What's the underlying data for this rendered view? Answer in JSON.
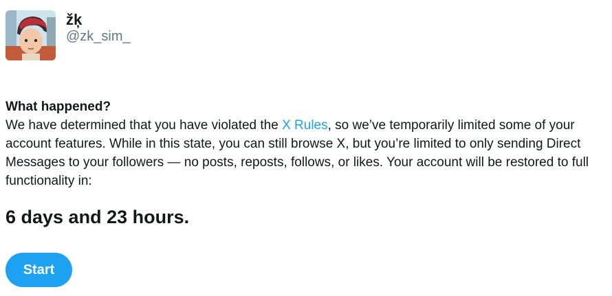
{
  "profile": {
    "display_name": "žķ",
    "handle": "@zk_sim_"
  },
  "notice": {
    "heading": "What happened?",
    "text_before_link": "We have determined that you have violated the ",
    "rules_link": "X Rules",
    "text_after_link": ", so we’ve temporarily limited some of your account features. While in this state, you can still browse X, but you’re limited to only sending Direct Messages to your followers — no posts, reposts, follows, or likes. Your account will be restored to full functionality in:",
    "countdown": "6 days and 23 hours."
  },
  "actions": {
    "start_label": "Start"
  },
  "colors": {
    "accent": "#1da1f2",
    "text": "#14171a",
    "muted": "#657786"
  }
}
